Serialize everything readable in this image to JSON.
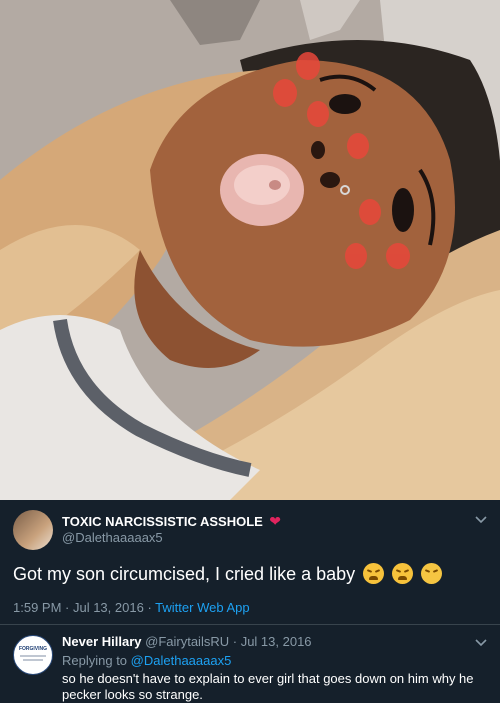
{
  "photo": {
    "subject": "selfie"
  },
  "tweet": {
    "display_name": "TOXIC NARCISSISTIC ASSHOLE",
    "heart": "❤",
    "handle": "@Dalethaaaaax5",
    "text": "Got my son circumcised, I cried like a baby",
    "emojis": [
      "weary-face-icon",
      "weary-face-icon",
      "relieved-face-icon"
    ],
    "time": "1:59 PM · Jul 13, 2016",
    "separator": "·",
    "source": "Twitter Web App"
  },
  "reply": {
    "display_name": "Never Hillary",
    "handle": "@FairytailsRU",
    "sep": "·",
    "date": "Jul 13, 2016",
    "replying_prefix": "Replying to",
    "replying_handle": "@Dalethaaaaax5",
    "text_line1": "so he doesn't have to explain to ever girl that goes down on him why he",
    "text_line2": "pecker looks so strange.",
    "avatar_text": "FORGIVING"
  },
  "colors": {
    "background": "#15202b",
    "secondary_text": "#8899a6",
    "link": "#1da1f2",
    "heart": "#e0245e",
    "divider": "#38444d"
  },
  "icons": {
    "chevron": "chevron-down-icon"
  }
}
